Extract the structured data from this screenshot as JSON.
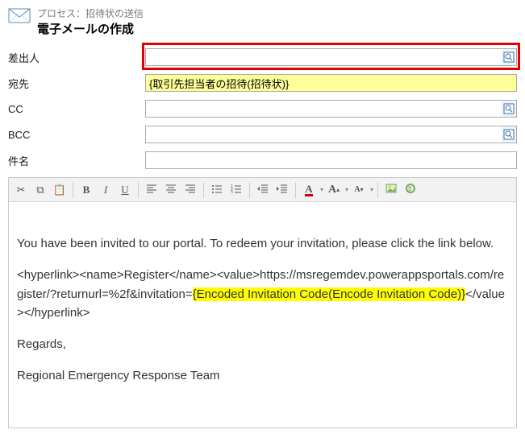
{
  "header": {
    "process_prefix": "プロセス：",
    "process_name": "招待状の送信",
    "title": "電子メールの作成"
  },
  "form": {
    "from_label": "差出人",
    "from_value": "",
    "to_label": "宛先",
    "to_value": "{取引先担当者の招待(招待状)}",
    "cc_label": "CC",
    "cc_value": "",
    "bcc_label": "BCC",
    "bcc_value": "",
    "subject_label": "件名",
    "subject_value": ""
  },
  "toolbar": {
    "cut": "cut",
    "copy": "copy",
    "paste": "paste",
    "bold": "B",
    "italic": "I",
    "underline": "U",
    "align_left": "align-left",
    "align_center": "align-center",
    "align_right": "align-right",
    "list_bullet": "list-bullet",
    "list_number": "list-number",
    "outdent": "outdent",
    "indent": "indent",
    "font_color": "A",
    "font_size": "A",
    "font_size_small": "A",
    "image": "image",
    "slug": "slug"
  },
  "body": {
    "p1": "You have been invited to our portal. To redeem your invitation, please click the link below.",
    "p2a": "<hyperlink><name>Register</name><value>https://msregemdev.powerappsportals.com/register/?returnurl=%2f&invitation=",
    "p2_hl": "{Encoded Invitation Code(Encode Invitation Code)}",
    "p2b": "</value></hyperlink>",
    "p3": "Regards,",
    "p4": "Regional Emergency Response Team"
  }
}
